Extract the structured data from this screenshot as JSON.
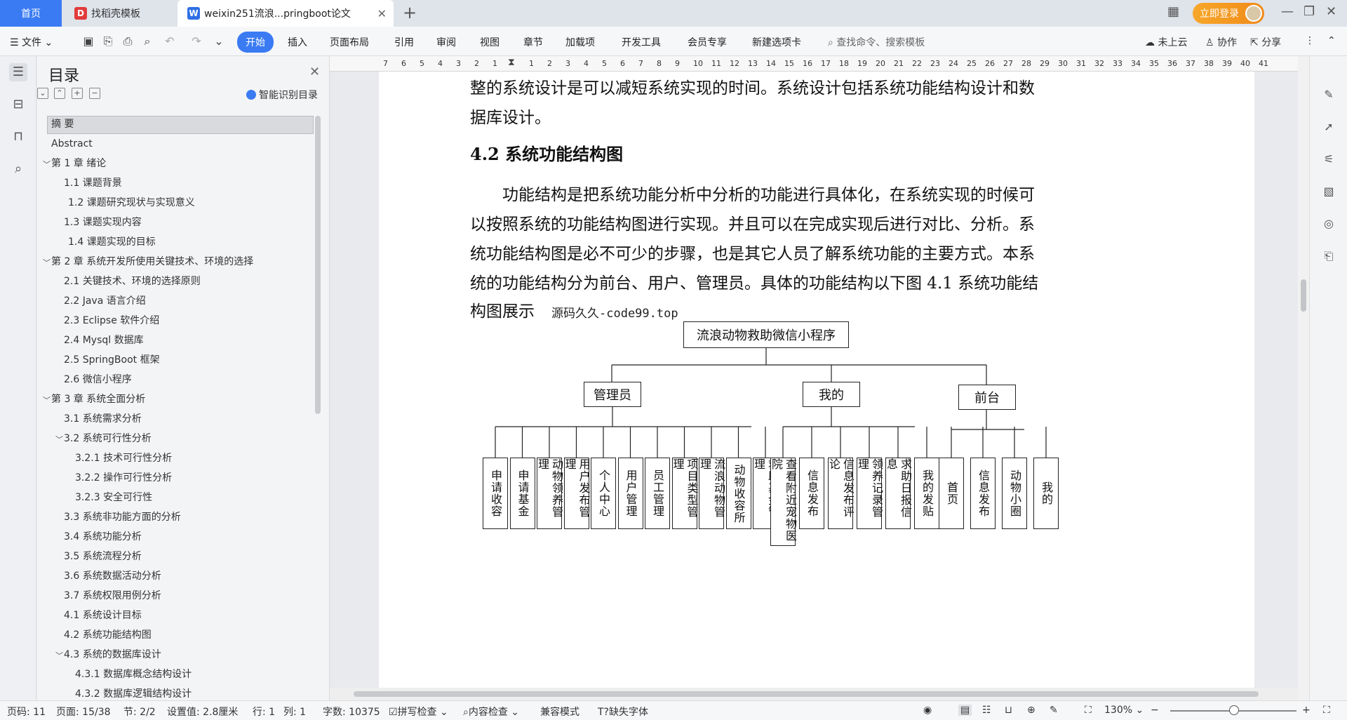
{
  "tabs": {
    "home": "首页",
    "daoke": "找稻壳模板",
    "doc": "weixin251流浪...pringboot论文",
    "login": "立即登录"
  },
  "menu": {
    "file": "文件",
    "items": [
      "开始",
      "插入",
      "页面布局",
      "引用",
      "审阅",
      "视图",
      "章节",
      "加载项",
      "开发工具",
      "会员专享",
      "新建选项卡"
    ],
    "search": "查找命令、搜索模板",
    "cloud": "未上云",
    "collab": "协作",
    "share": "分享"
  },
  "toc": {
    "title": "目录",
    "smart": "智能识别目录",
    "items": [
      "摘 要",
      "Abstract",
      "第 1 章 绪论",
      "1.1 课题背景",
      "1.2 课题研究现状与实现意义",
      "1.3 课题实现内容",
      "1.4 课题实现的目标",
      "第 2 章 系统开发所使用关键技术、环境的选择",
      "2.1 关键技术、环境的选择原则",
      "2.2 Java 语言介绍",
      "2.3 Eclipse 软件介绍",
      "2.4 Mysql 数据库",
      "2.5 SpringBoot 框架",
      "2.6 微信小程序",
      "第 3 章 系统全面分析",
      "3.1 系统需求分析",
      "3.2 系统可行性分析",
      "3.2.1 技术可行性分析",
      "3.2.2 操作可行性分析",
      "3.2.3 安全可行性",
      "3.3 系统非功能方面的分析",
      "3.4 系统功能分析",
      "3.5 系统流程分析",
      "3.6 系统数据活动分析",
      "3.7 系统权限用例分析",
      "4.1 系统设计目标",
      "4.2 系统功能结构图",
      "4.3 系统的数据库设计",
      "4.3.1 数据库概念结构设计",
      "4.3.2 数据库逻辑结构设计"
    ]
  },
  "ruler": [
    "7",
    "6",
    "5",
    "4",
    "3",
    "2",
    "1",
    "",
    "1",
    "2",
    "3",
    "4",
    "5",
    "6",
    "7",
    "8",
    "9",
    "10",
    "11",
    "12",
    "13",
    "14",
    "15",
    "16",
    "17",
    "18",
    "19",
    "20",
    "21",
    "22",
    "23",
    "24",
    "25",
    "26",
    "27",
    "28",
    "29",
    "30",
    "31",
    "32",
    "33",
    "34",
    "35",
    "36",
    "37",
    "38",
    "39",
    "40",
    "41"
  ],
  "doc": {
    "line1": "整的系统设计是可以减短系统实现的时间。系统设计包括系统功能结构设计和数",
    "line2": "据库设计。",
    "heading": "4.2 系统功能结构图",
    "p1": "功能结构是把系统功能分析中分析的功能进行具体化，在系统实现的时候可",
    "p2": "以按照系统的功能结构图进行实现。并且可以在完成实现后进行对比、分析。系",
    "p3": "统功能结构图是必不可少的步骤，也是其它人员了解系统功能的主要方式。本系",
    "p4": "统的功能结构分为前台、用户、管理员。具体的功能结构以下图 4.1 系统功能结",
    "p5": "构图展示",
    "watermark": "源码久久-code99.top"
  },
  "diagram": {
    "root": "流浪动物救助微信小程序",
    "admin": "管理员",
    "mine": "我的",
    "front": "前台",
    "admin_children": [
      "申请收容",
      "申请基金",
      "动物领养管理",
      "用户发布管理",
      "个人中心",
      "用户管理",
      "员工管理",
      "项目类型管理",
      "流浪动物管理",
      "动物收容所",
      "救助基金管理"
    ],
    "mine_children": [
      "查看附近宠物医院",
      "信息发布",
      "信息发布评论",
      "领养记录管理",
      "求助日报信息",
      "我的发贴"
    ],
    "front_children": [
      "首页",
      "信息发布",
      "动物小圈",
      "我的"
    ]
  },
  "status": {
    "page_no": "页码: 11",
    "page": "页面: 15/38",
    "section": "节: 2/2",
    "setting": "设置值: 2.8厘米",
    "row": "行: 1",
    "col": "列: 1",
    "words": "字数: 10375",
    "spell": "拼写检查",
    "content": "内容检查",
    "compat": "兼容模式",
    "font_missing": "缺失字体",
    "zoom": "130%"
  }
}
